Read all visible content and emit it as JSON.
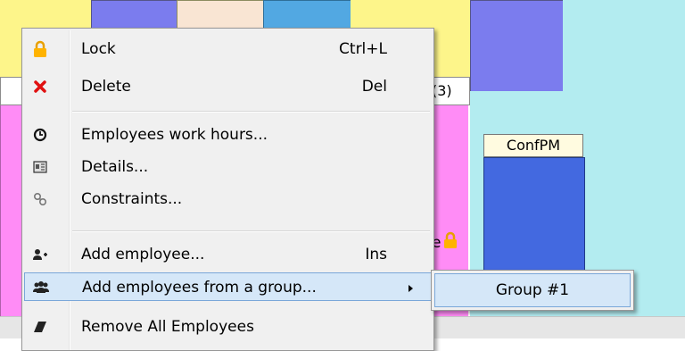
{
  "background": {
    "column_header_fragment": "(3)",
    "conf_block_label": "ConfPM",
    "text_fragment_e": "e"
  },
  "menu": {
    "items": [
      {
        "label": "Lock",
        "shortcut": "Ctrl+L",
        "icon": "lock-icon"
      },
      {
        "label": "Delete",
        "shortcut": "Del",
        "icon": "delete-x-icon"
      },
      {
        "label": "Employees work hours...",
        "shortcut": "",
        "icon": "clock-icon"
      },
      {
        "label": "Details...",
        "shortcut": "",
        "icon": "details-card-icon"
      },
      {
        "label": "Constraints...",
        "shortcut": "",
        "icon": "link-icon"
      },
      {
        "label": "Add employee...",
        "shortcut": "Ins",
        "icon": "add-user-icon"
      },
      {
        "label": "Add employees from a group...",
        "shortcut": "",
        "icon": "users-group-icon"
      },
      {
        "label": "Remove All Employees",
        "shortcut": "",
        "icon": "eraser-icon"
      }
    ],
    "selected_index": 6
  },
  "submenu": {
    "items": [
      {
        "label": "Group #1"
      }
    ]
  },
  "colors": {
    "selection": "#d5e7f8",
    "menu_bg": "#f0f0f0",
    "pink_block": "#ff8cf6",
    "blue_block": "#4369e0",
    "cyan_bg": "#b3ecf0",
    "yellow_block": "#fdf58a"
  }
}
